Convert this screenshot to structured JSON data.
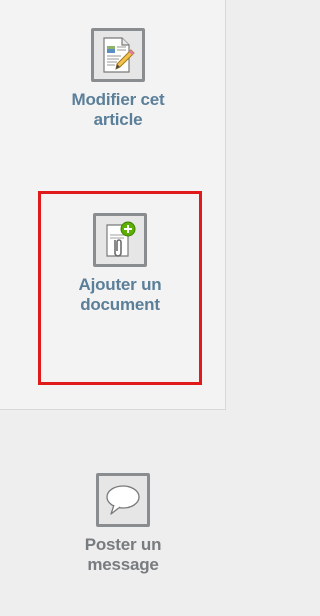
{
  "sidebar": {
    "actions": [
      {
        "label_line1": "Modifier cet",
        "label_line2": "article",
        "icon": "edit-document-icon"
      },
      {
        "label_line1": "Ajouter un",
        "label_line2": "document",
        "icon": "attach-document-icon"
      },
      {
        "label_line1": "Poster un",
        "label_line2": "message",
        "icon": "speech-bubble-icon"
      }
    ]
  },
  "colors": {
    "label_blue": "#5b7f99",
    "label_gray": "#787c80",
    "highlight": "#e01a1a",
    "icon_border": "#8a8d90",
    "add_badge": "#5cb000"
  }
}
